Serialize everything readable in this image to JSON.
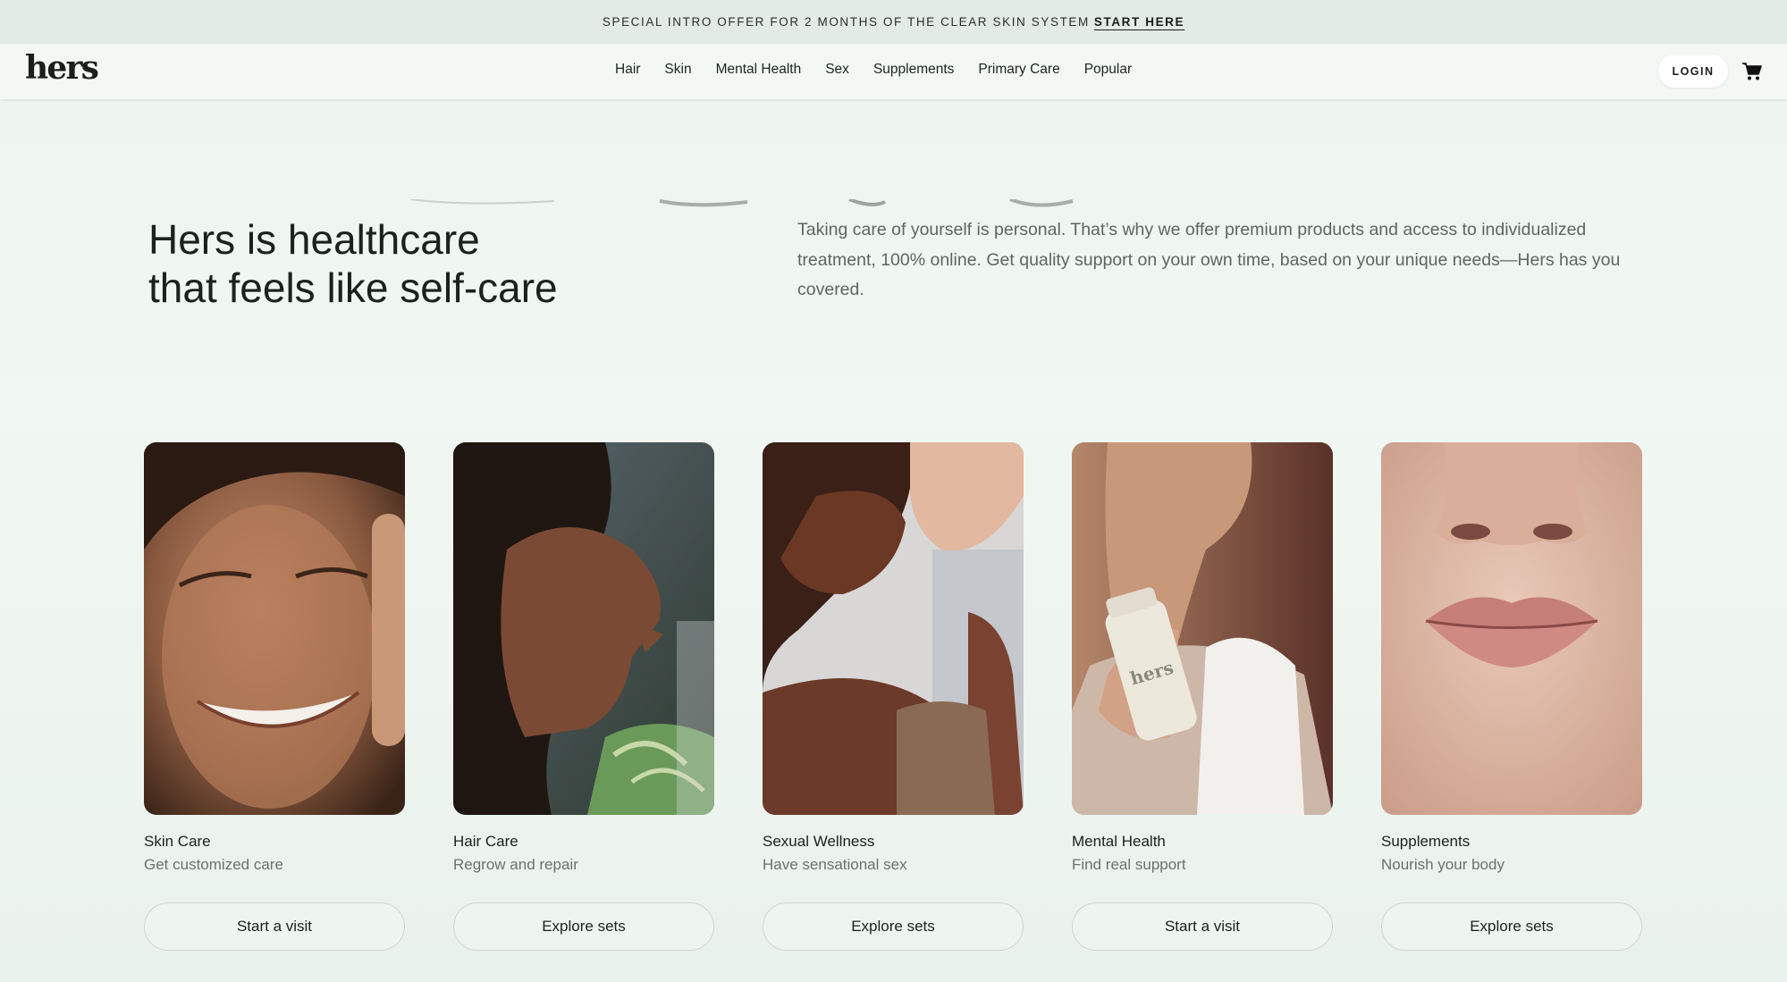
{
  "announcement": {
    "text": "SPECIAL INTRO OFFER FOR 2 MONTHS OF THE CLEAR SKIN SYSTEM",
    "cta": "START HERE"
  },
  "header": {
    "logo": "hers",
    "nav": [
      "Hair",
      "Skin",
      "Mental Health",
      "Sex",
      "Supplements",
      "Primary Care",
      "Popular"
    ],
    "login": "LOGIN",
    "cart_icon": "cart-icon"
  },
  "hero": {
    "headline_line1": "Hers is healthcare",
    "headline_line2": "that feels like self-care",
    "intro": "Taking care of yourself is personal. That’s why we offer premium products and access to individualized treatment, 100% online. Get quality support on your own time, based on your unique needs—Hers has you covered."
  },
  "cards": [
    {
      "title": "Skin Care",
      "subtitle": "Get customized care",
      "button": "Start a visit",
      "image": "smiling-face-photo"
    },
    {
      "title": "Hair Care",
      "subtitle": "Regrow and repair",
      "button": "Explore sets",
      "image": "shower-profile-photo"
    },
    {
      "title": "Sexual Wellness",
      "subtitle": "Have sensational sex",
      "button": "Explore sets",
      "image": "couple-kiss-photo"
    },
    {
      "title": "Mental Health",
      "subtitle": "Find real support",
      "button": "Start a visit",
      "image": "bottle-in-hand-photo",
      "bottle_label": "hers"
    },
    {
      "title": "Supplements",
      "subtitle": "Nourish your body",
      "button": "Explore sets",
      "image": "lips-closeup-photo"
    }
  ],
  "colors": {
    "background": "#edf3ef",
    "announcement_bg": "#e2ebe6",
    "nav_bg": "#f3f8f5",
    "text": "#1c211d",
    "muted_text": "#6b716d"
  }
}
